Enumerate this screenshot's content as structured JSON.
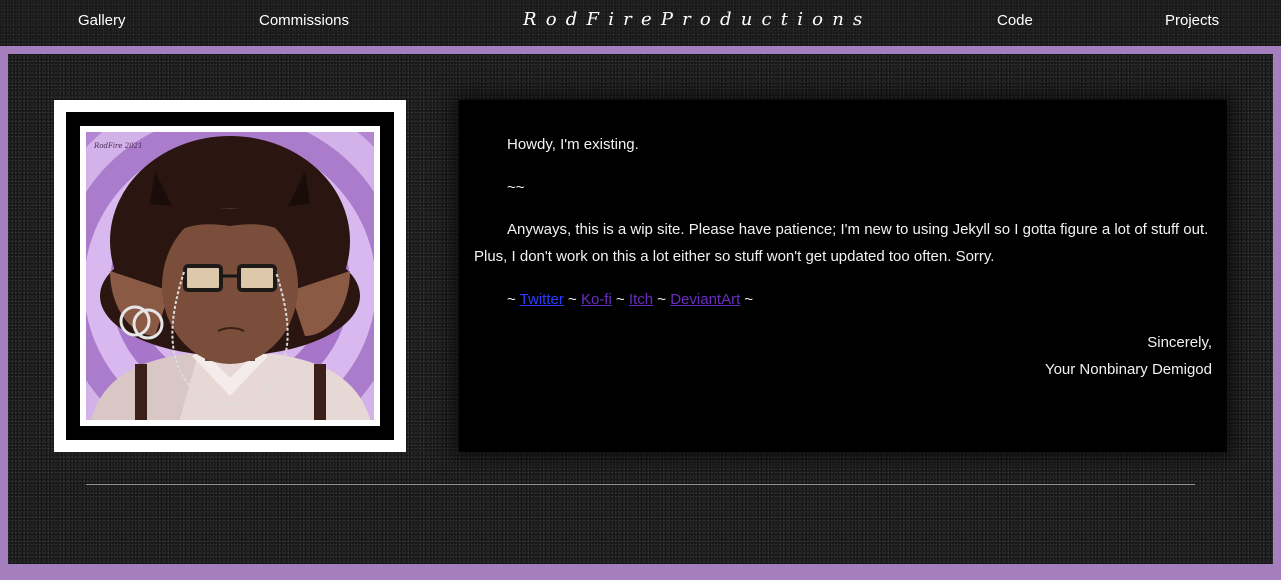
{
  "nav": {
    "left": [
      {
        "label": "Gallery"
      },
      {
        "label": "Commissions"
      }
    ],
    "brand": "RodFireProductions",
    "right": [
      {
        "label": "Code"
      },
      {
        "label": "Projects"
      }
    ]
  },
  "avatar": {
    "signature": "RodFire 2021"
  },
  "intro": {
    "greeting": "Howdy, I'm existing.",
    "separator": "~~",
    "body": "Anyways, this is a wip site. Please have patience; I'm new to using Jekyll so I gotta figure a lot of stuff out. Plus, I don't work on this a lot either so stuff won't get updated too often. Sorry.",
    "links": [
      {
        "label": "Twitter"
      },
      {
        "label": "Ko-fi"
      },
      {
        "label": "Itch"
      },
      {
        "label": "DeviantArt"
      }
    ],
    "link_separator": "~",
    "closing": "Sincerely,",
    "signature": "Your Nonbinary Demigod"
  },
  "colors": {
    "accent": "#a57fbd",
    "link_unvisited": "#2f3cff",
    "link_visited": "#6a2cc0",
    "panel": "#000000"
  }
}
